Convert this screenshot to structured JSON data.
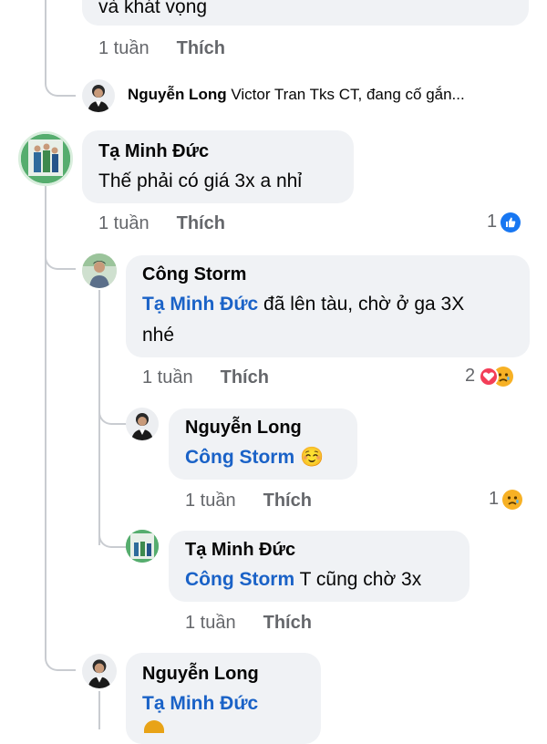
{
  "top_comment": {
    "text_tail": "và khát vọng",
    "time": "1 tuần",
    "like_label": "Thích"
  },
  "collapsed_reply": {
    "author": "Nguyễn Long",
    "text": "Victor Tran Tks CT, đang cố gắn..."
  },
  "comment_duc": {
    "author": "Tạ Minh Đức",
    "text": "Thế phải có giá 3x a nhỉ",
    "time": "1 tuần",
    "like_label": "Thích",
    "reaction_count": "1",
    "reaction_icon": "like-icon"
  },
  "reply_storm": {
    "author": "Công Storm",
    "mention": "Tạ Minh Đức",
    "text_line1": " đã lên tàu, chờ ở ga 3X",
    "text_line2": "nhé",
    "time": "1 tuần",
    "like_label": "Thích",
    "reaction_count": "2",
    "reaction_icons": [
      "love-icon",
      "sad-icon"
    ]
  },
  "reply_long_1": {
    "author": "Nguyễn Long",
    "mention": "Công Storm",
    "emoji": "☺️",
    "time": "1 tuần",
    "like_label": "Thích",
    "reaction_count": "1",
    "reaction_icon": "sad-icon"
  },
  "reply_duc_2": {
    "author": "Tạ Minh Đức",
    "mention": "Công Storm",
    "text": " T cũng chờ 3x",
    "time": "1 tuần",
    "like_label": "Thích"
  },
  "reply_long_2": {
    "author": "Nguyễn Long",
    "mention": "Tạ Minh Đức"
  },
  "colors": {
    "mention": "#1a62c7",
    "like_blue": "#1877f2",
    "love_red": "#f33e58",
    "sad_yellow": "#f7b125",
    "bubble_bg": "#f0f2f5",
    "meta_gray": "#65676b"
  }
}
